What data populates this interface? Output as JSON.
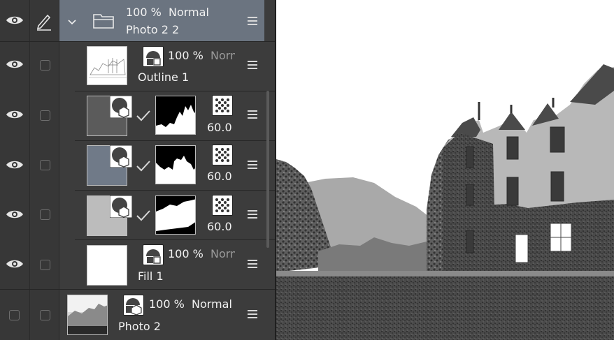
{
  "layers": [
    {
      "id": "group",
      "opacity": "100 %",
      "blend": "Normal",
      "name": "Photo 2 2"
    },
    {
      "id": "outline",
      "opacity": "100 %",
      "blend": "Norm",
      "name": "Outline 1"
    },
    {
      "id": "tone1",
      "value": "60.0 L"
    },
    {
      "id": "tone2",
      "value": "60.0 L"
    },
    {
      "id": "tone3",
      "value": "60.0 L"
    },
    {
      "id": "fill",
      "opacity": "100 %",
      "blend": "Norm",
      "name": "Fill 1"
    },
    {
      "id": "photo",
      "opacity": "100 %",
      "blend": "Normal",
      "name": "Photo 2"
    }
  ],
  "icons": {
    "visibility": "eye-icon",
    "edit": "pen-icon",
    "folder": "folder-icon",
    "expand": "chevron-down-icon",
    "menu": "hamburger-menu-icon",
    "tone_pattern": "dot-pattern-icon",
    "check": "checkmark-icon"
  },
  "colors": {
    "panel_bg": "#3c3c3c",
    "selected_row": "#6b7480",
    "canvas_sky": "#ffffff"
  }
}
